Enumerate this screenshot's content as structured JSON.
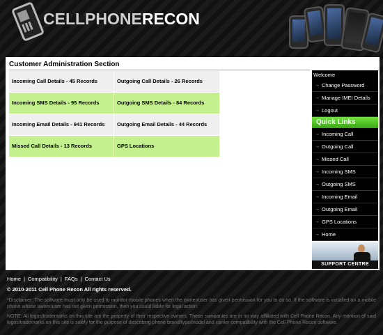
{
  "header": {
    "logo_part1": "CELLPHONE",
    "logo_part2": "RECON"
  },
  "main": {
    "section_title": "Customer Administration Section",
    "rows": [
      {
        "left": "Incoming Call Details - 45 Records",
        "right": "Outgoing Call Details - 26 Records"
      },
      {
        "left": "Incoming SMS Details - 95 Records",
        "right": "Outgoing SMS Details - 84 Records"
      },
      {
        "left": "Incoming Email Details - 941 Records",
        "right": "Outgoing Email Details - 44 Records"
      },
      {
        "left": "Missed Call Details - 13 Records",
        "right": "GPS Locations"
      }
    ]
  },
  "sidebar": {
    "welcome": "Welcome",
    "account_items": [
      "Change Password",
      "Manage IMEI Details",
      "Logout"
    ],
    "quick_links_title": "Quick Links",
    "quick_links": [
      "Incoming Call",
      "Outgoing Call",
      "Missed Call",
      "Incoming SMS",
      "Outgoing SMS",
      "Incoming Email",
      "Outgoing Email",
      "GPS Locations",
      "Home"
    ],
    "support_label": "SUPPORT CENTRE"
  },
  "footer": {
    "links": [
      "Home",
      "Compatibility",
      "FAQs",
      "Contact Us"
    ],
    "copyright": "© 2010-2011 Cell Phone Recon All rights reserved.",
    "disclaimer": "*Disclaimer: The software must only be used to monitor mobile phones when the owner/user has given permission for you to do so. If the software is installed on a mobile phone whose owner/user has not given permission, then you could liable for legal action.",
    "note": "NOTE: All logos/trademarks on this site are the property of their respective owners. These companies are in no way affiliated with Cell Phone Recon. Any mention of said logos/trademarks on this site is solely for the purpose of describing phone brand/type/model and carrier compatibility with the Cell Phone Recon software."
  }
}
